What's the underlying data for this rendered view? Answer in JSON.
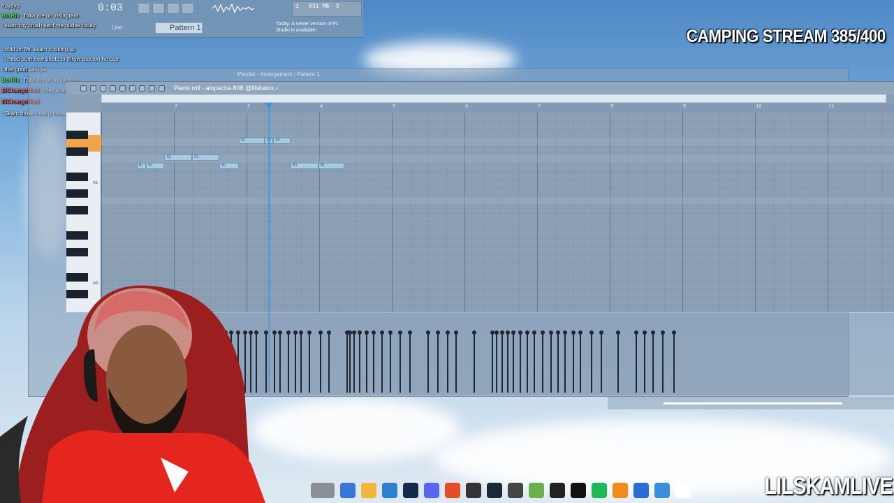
{
  "overlay": {
    "stream_title": "CAMPING STREAM 385/400",
    "channel_name": "LILSKAMLIVE"
  },
  "toolbar": {
    "time": "0:03",
    "pattern_label": "Pattern 1",
    "snap_label": "Line",
    "notice": "Today: A newer version of FL Studio is available!",
    "memory": "831 MB",
    "voices": "1",
    "cpu": "3"
  },
  "chat": [
    {
      "user": "",
      "message": "Yoyoyo",
      "color": "#ffffff"
    },
    {
      "user": "BotRix",
      "message": ": follw me on instagram",
      "color": "#54e85a"
    },
    {
      "user": "",
      "message": ": skam my crush sent me nudes today",
      "color": "#ff5a5a"
    },
    {
      "user": "",
      "message": ": hold on Mr. skam cooking up",
      "color": "#ff5a5a"
    },
    {
      "user": "",
      "message": ": I need sum new beats to throw ass too no cap",
      "color": "#ff5a5a"
    },
    {
      "user": "",
      "message": ": this good sample",
      "color": "#ff5a5a"
    },
    {
      "user": "BotRix",
      "message": ": follw me on instagram",
      "color": "#54e85a"
    },
    {
      "user": "ElChangoMazi",
      "message": ": Hey scam",
      "color": "#ff5a5a"
    },
    {
      "user": "ElChangoMazi",
      "message": ":",
      "color": "#ff5a5a"
    },
    {
      "user": "",
      "message": ": Skam those headphones you got too op",
      "color": "#e48aff"
    }
  ],
  "playlist": {
    "title": "Playlist - Arrangement › Pattern 1"
  },
  "piano_roll": {
    "title": "Piano roll - alopecha 808 @lilskamx ›",
    "bar_numbers": [
      "2",
      "3",
      "4",
      "5",
      "6",
      "7",
      "8",
      "9",
      "10",
      "11"
    ],
    "octave_labels": [
      "A1",
      "A0"
    ],
    "notes": [
      {
        "label": "D2",
        "pitch": "D2",
        "start": 2.88,
        "length": 0.36
      },
      {
        "label": "D2",
        "pitch": "D2",
        "start": 3.24,
        "length": 0.12
      },
      {
        "label": "D2",
        "pitch": "D2",
        "start": 3.36,
        "length": 0.24
      },
      {
        "label": "C2",
        "pitch": "C2",
        "start": 1.86,
        "length": 0.38
      },
      {
        "label": "C2",
        "pitch": "C2",
        "start": 2.24,
        "length": 0.38
      },
      {
        "label": "B1",
        "pitch": "B1",
        "start": 1.48,
        "length": 0.13
      },
      {
        "label": "B1",
        "pitch": "B1",
        "start": 1.61,
        "length": 0.25
      },
      {
        "label": "B1",
        "pitch": "B1",
        "start": 2.62,
        "length": 0.26
      },
      {
        "label": "B1",
        "pitch": "B1",
        "start": 3.6,
        "length": 0.38
      },
      {
        "label": "B1",
        "pitch": "B1",
        "start": 3.98,
        "length": 0.36
      }
    ]
  }
}
